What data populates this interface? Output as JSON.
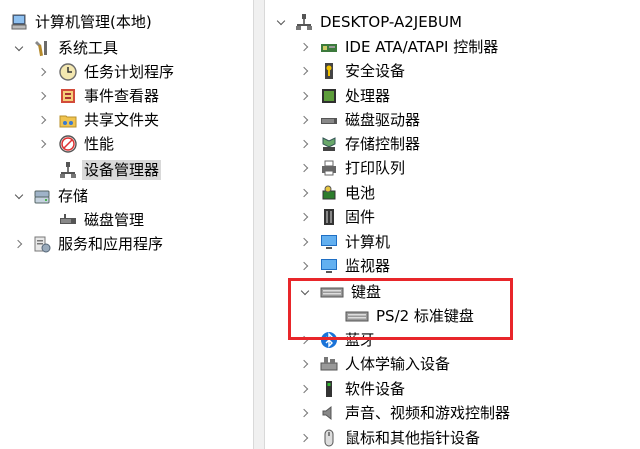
{
  "left_tree": {
    "root": "计算机管理(本地)",
    "system_tools": "系统工具",
    "task_scheduler": "任务计划程序",
    "event_viewer": "事件查看器",
    "shared_folders": "共享文件夹",
    "performance": "性能",
    "device_manager": "设备管理器",
    "storage": "存储",
    "disk_management": "磁盘管理",
    "services_apps": "服务和应用程序"
  },
  "right_tree": {
    "computer_name": "DESKTOP-A2JEBUM",
    "ide": "IDE ATA/ATAPI 控制器",
    "security": "安全设备",
    "processor": "处理器",
    "disk_drives": "磁盘驱动器",
    "storage_controllers": "存储控制器",
    "print_queue": "打印队列",
    "battery": "电池",
    "firmware": "固件",
    "computer": "计算机",
    "monitor": "监视器",
    "keyboard": "键盘",
    "ps2_keyboard": "PS/2 标准键盘",
    "bluetooth": "蓝牙",
    "hid": "人体学输入设备",
    "software_devices": "软件设备",
    "sound": "声音、视频和游戏控制器",
    "mice": "鼠标和其他指针设备"
  },
  "colors": {
    "highlight": "#e8262a",
    "selection": "#d9d9d9"
  }
}
